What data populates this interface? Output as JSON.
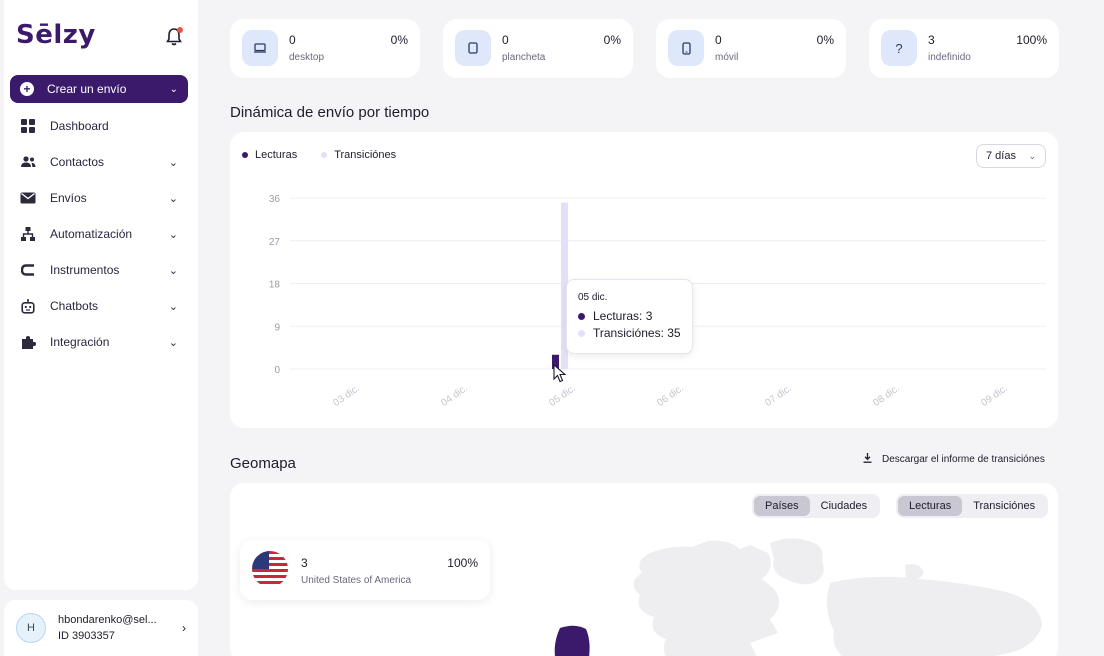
{
  "brand": {
    "logo_text": "Sēlzy",
    "accent": "#3b1a6b"
  },
  "sidebar": {
    "create_button": "Crear un envío",
    "items": [
      {
        "label": "Dashboard",
        "icon": "dashboard-icon",
        "has_chevron": false
      },
      {
        "label": "Contactos",
        "icon": "contacts-icon",
        "has_chevron": true
      },
      {
        "label": "Envíos",
        "icon": "mail-icon",
        "has_chevron": true
      },
      {
        "label": "Automatización",
        "icon": "automation-icon",
        "has_chevron": true
      },
      {
        "label": "Instrumentos",
        "icon": "instruments-icon",
        "has_chevron": true
      },
      {
        "label": "Chatbots",
        "icon": "chatbot-icon",
        "has_chevron": true
      },
      {
        "label": "Integración",
        "icon": "puzzle-icon",
        "has_chevron": true
      }
    ],
    "user": {
      "initial": "H",
      "email": "hbondarenko@sel...",
      "id": "ID 3903357"
    }
  },
  "devices": [
    {
      "value": "0",
      "label": "desktop",
      "percent": "0%",
      "icon": "desktop-icon"
    },
    {
      "value": "0",
      "label": "plancheta",
      "percent": "0%",
      "icon": "tablet-icon"
    },
    {
      "value": "0",
      "label": "móvil",
      "percent": "0%",
      "icon": "mobile-icon"
    },
    {
      "value": "3",
      "label": "indefinido",
      "percent": "100%",
      "icon": "question-icon"
    }
  ],
  "dynamics": {
    "title": "Dinámica de envío por tiempo",
    "legend": {
      "reads": "Lecturas",
      "transitions": "Transiciónes"
    },
    "period": "7 días",
    "tooltip": {
      "date": "05 dic.",
      "reads": "Lecturas: 3",
      "transitions": "Transiciónes: 35"
    }
  },
  "chart_data": {
    "type": "bar",
    "categories": [
      "03 dic.",
      "04 dic.",
      "05 dic.",
      "06 dic.",
      "07 dic.",
      "08 dic.",
      "09 dic."
    ],
    "series": [
      {
        "name": "Lecturas",
        "values": [
          0,
          0,
          3,
          0,
          0,
          0,
          0
        ],
        "color": "#3b1a6b"
      },
      {
        "name": "Transiciónes",
        "values": [
          0,
          0,
          35,
          0,
          0,
          0,
          0
        ],
        "color": "#e4dffa"
      }
    ],
    "yticks": [
      0,
      9,
      18,
      27,
      36
    ],
    "ylim": [
      0,
      36
    ],
    "grid": true,
    "legend_position": "top-left"
  },
  "geomap": {
    "title": "Geomapa",
    "download": "Descargar el informe de transiciónes",
    "scope_toggle": {
      "countries": "Países",
      "cities": "Ciudades",
      "active": "Países"
    },
    "metric_toggle": {
      "reads": "Lecturas",
      "transitions": "Transiciónes",
      "active": "Lecturas"
    },
    "country": {
      "value": "3",
      "name": "United States of America",
      "percent": "100%",
      "flag": "usa-flag-icon"
    }
  }
}
